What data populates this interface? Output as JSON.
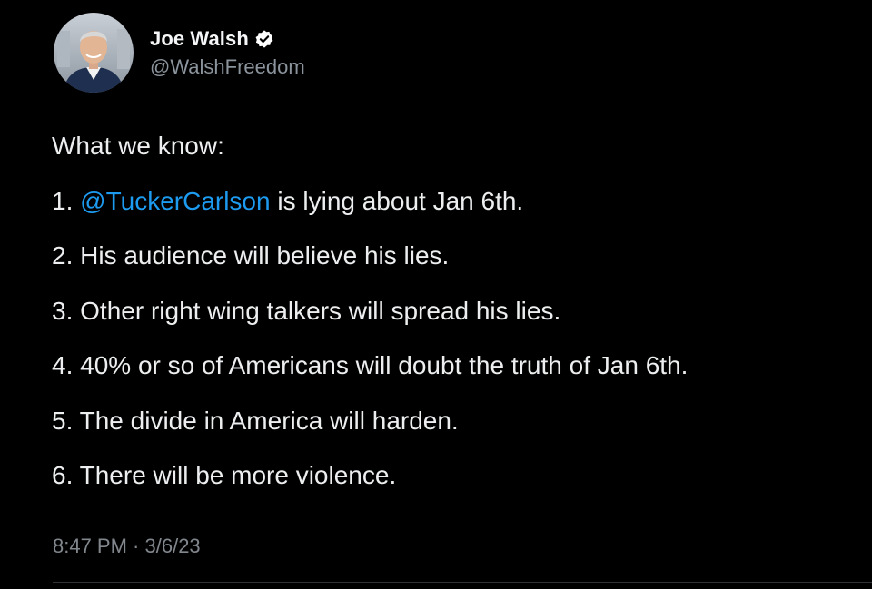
{
  "colors": {
    "background": "#000000",
    "text": "#e7e9ea",
    "secondary": "#8b949c",
    "link": "#1d9bf0",
    "verified_badge": "#ffffff"
  },
  "author": {
    "display_name": "Joe Walsh",
    "handle": "@WalshFreedom",
    "verified_icon": "verified-badge-icon",
    "avatar": "profile-photo"
  },
  "tweet": {
    "intro": "What we know:",
    "items": [
      {
        "prefix": "1. ",
        "mention": "@TuckerCarlson",
        "text": " is lying about Jan 6th."
      },
      {
        "prefix": "2. ",
        "text": "His audience will believe his lies."
      },
      {
        "prefix": "3. ",
        "text": "Other right wing talkers will spread his lies."
      },
      {
        "prefix": "4. ",
        "text": "40% or so of Americans will doubt the truth of Jan 6th."
      },
      {
        "prefix": "5. ",
        "text": "The divide in America will harden."
      },
      {
        "prefix": "6. ",
        "text": "There will be more violence."
      }
    ],
    "time": "8:47 PM",
    "separator": " · ",
    "date": "3/6/23"
  }
}
